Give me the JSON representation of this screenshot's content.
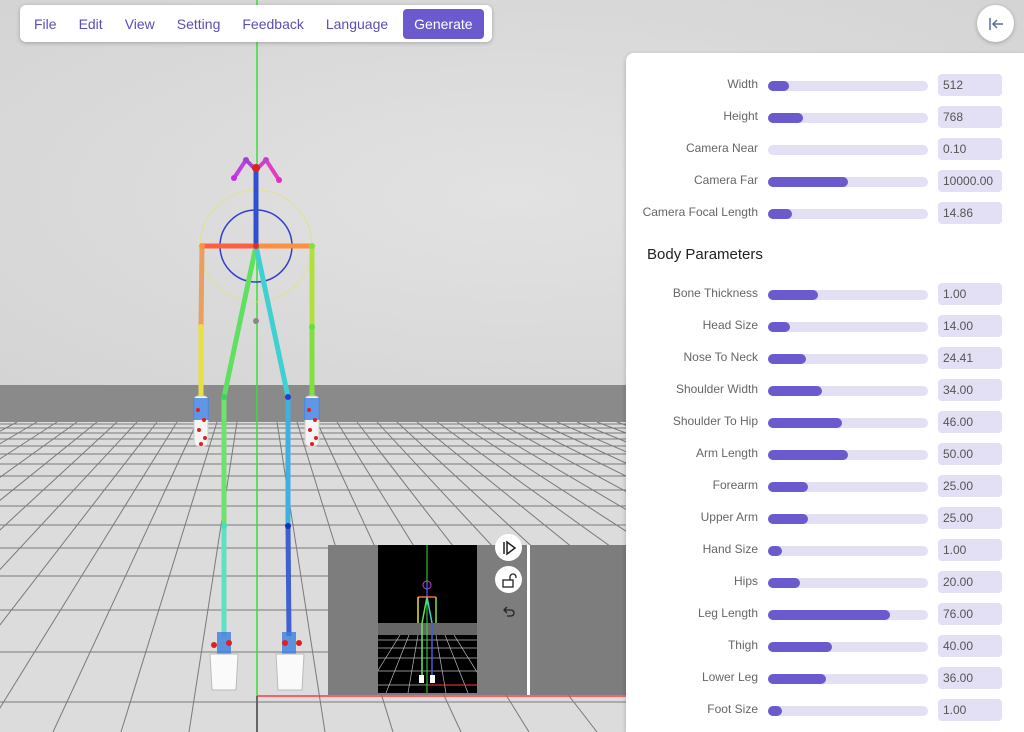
{
  "menu": {
    "items": [
      "File",
      "Edit",
      "View",
      "Setting",
      "Feedback",
      "Language"
    ],
    "generate_label": "Generate"
  },
  "panel": {
    "camera_params": [
      {
        "label": "Width",
        "value": "512",
        "fill": 0.13
      },
      {
        "label": "Height",
        "value": "768",
        "fill": 0.22
      },
      {
        "label": "Camera Near",
        "value": "0.10",
        "fill": 0.0
      },
      {
        "label": "Camera Far",
        "value": "10000.00",
        "fill": 0.5
      },
      {
        "label": "Camera Focal Length",
        "value": "14.86",
        "fill": 0.15
      }
    ],
    "body_title": "Body Parameters",
    "body_params": [
      {
        "label": "Bone Thickness",
        "value": "1.00",
        "fill": 0.31
      },
      {
        "label": "Head Size",
        "value": "14.00",
        "fill": 0.14
      },
      {
        "label": "Nose To Neck",
        "value": "24.41",
        "fill": 0.24
      },
      {
        "label": "Shoulder Width",
        "value": "34.00",
        "fill": 0.34
      },
      {
        "label": "Shoulder To Hip",
        "value": "46.00",
        "fill": 0.46
      },
      {
        "label": "Arm Length",
        "value": "50.00",
        "fill": 0.5
      },
      {
        "label": "Forearm",
        "value": "25.00",
        "fill": 0.25
      },
      {
        "label": "Upper Arm",
        "value": "25.00",
        "fill": 0.25
      },
      {
        "label": "Hand Size",
        "value": "1.00",
        "fill": 0.09
      },
      {
        "label": "Hips",
        "value": "20.00",
        "fill": 0.2
      },
      {
        "label": "Leg Length",
        "value": "76.00",
        "fill": 0.76
      },
      {
        "label": "Thigh",
        "value": "40.00",
        "fill": 0.4
      },
      {
        "label": "Lower Leg",
        "value": "36.00",
        "fill": 0.36
      },
      {
        "label": "Foot Size",
        "value": "1.00",
        "fill": 0.09
      }
    ]
  },
  "icons": {
    "collapse": "collapse-panel-icon",
    "play": "play-step-icon",
    "lock": "unlock-icon",
    "undo": "undo-icon"
  },
  "colors": {
    "accent": "#6a5acd",
    "track": "#e3e0f6",
    "x_axis": "#ff3b3b",
    "y_axis": "#3ddc3d"
  }
}
